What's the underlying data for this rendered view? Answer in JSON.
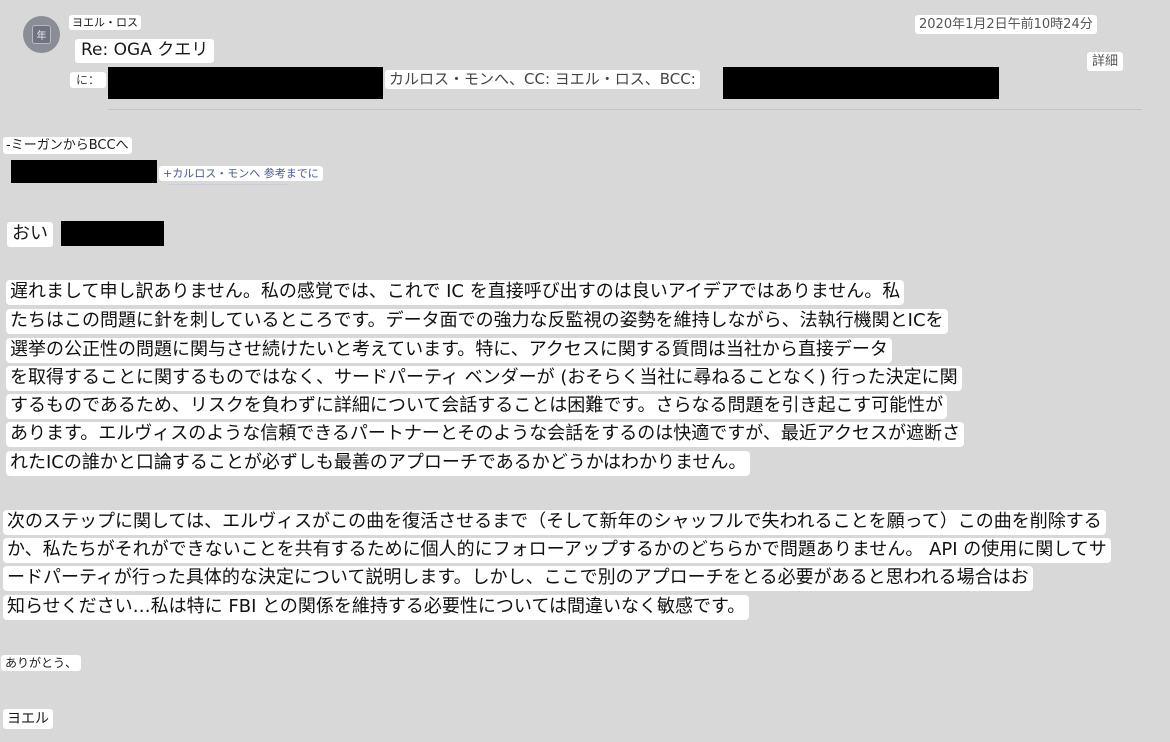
{
  "header": {
    "sender_name": "ヨエル・ロス",
    "avatar_glyph": "年",
    "subject": "Re: OGA クエリ",
    "timestamp": "2020年1月2日午前10時24分",
    "details_label": "詳細",
    "to_label": "に：",
    "recipients_text": "カルロス・モンへ、CC: ヨエル・ロス、BCC:"
  },
  "quote": {
    "bcc_note": "-ミーガンからBCCへ",
    "plus_note": "+カルロス・モンへ 参考までに"
  },
  "body": {
    "greeting": "おい",
    "paragraph1": [
      "遅れまして申し訳ありません。私の感覚では、これで IC を直接呼び出すのは良いアイデアではありません。私",
      "たちはこの問題に針を刺しているところです。データ面での強力な反監視の姿勢を維持しながら、法執行機関とICを",
      "選挙の公正性の問題に関与させ続けたいと考えています。特に、アクセスに関する質問は当社から直接データ",
      "を取得することに関するものではなく、サードパーティ ベンダーが (おそらく当社に尋ねることなく) 行った決定に関",
      "するものであるため、リスクを負わずに詳細について会話することは困難です。さらなる問題を引き起こす可能性が",
      "あります。エルヴィスのような信頼できるパートナーとそのような会話をするのは快適ですが、最近アクセスが遮断さ",
      "れたICの誰かと口論することが必ずしも最善のアプローチであるかどうかはわかりません。"
    ],
    "paragraph2": [
      "次のステップに関しては、エルヴィスがこの曲を復活させるまで（そして新年のシャッフルで失われることを願って）この曲を削除する",
      "か、私たちがそれができないことを共有するために個人的にフォローアップするかのどちらかで問題ありません。 API の使用に関してサ",
      "ードパーティが行った具体的な決定について説明します。しかし、ここで別のアプローチをとる必要があると思われる場合はお",
      "知らせください…私は特に FBI との関係を維持する必要性については間違いなく敏感です。"
    ],
    "closing": "ありがとう、",
    "signature": "ヨエル"
  }
}
